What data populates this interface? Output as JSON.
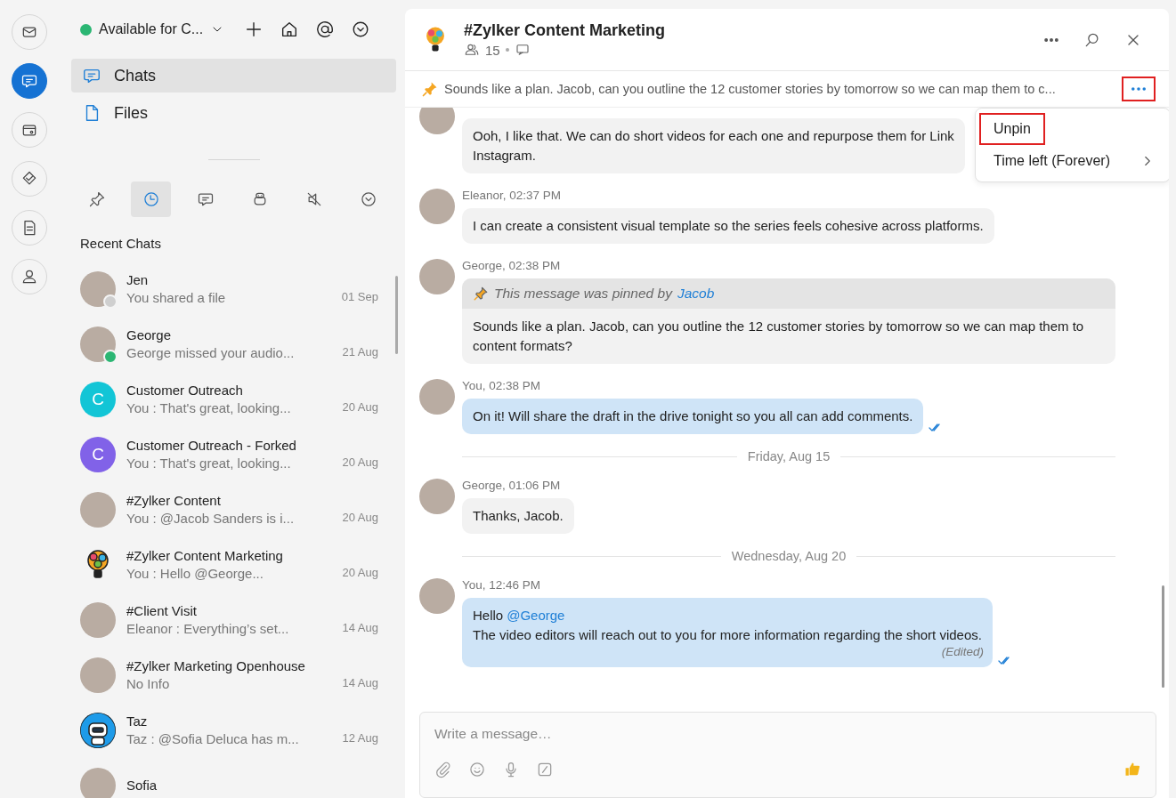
{
  "rail": [
    {
      "selected": false
    },
    {
      "selected": true
    },
    {
      "selected": false
    },
    {
      "selected": false
    },
    {
      "selected": false
    },
    {
      "selected": false
    }
  ],
  "panel": {
    "status": {
      "label": "Available for C...",
      "online": true
    },
    "nav": [
      {
        "label": "Chats",
        "selected": true
      },
      {
        "label": "Files",
        "selected": false
      }
    ],
    "filters": [
      {
        "selected": false
      },
      {
        "selected": true
      },
      {
        "selected": false
      },
      {
        "selected": false
      },
      {
        "selected": false
      },
      {
        "selected": false
      }
    ],
    "section_title": "Recent Chats",
    "chats": [
      {
        "name": "Jen",
        "preview": "You shared a file",
        "date": "01 Sep",
        "kind": "photo",
        "online": false
      },
      {
        "name": "George",
        "preview": "George missed your audio...",
        "date": "21 Aug",
        "kind": "photo",
        "online": true
      },
      {
        "name": "Customer Outreach",
        "preview": "You : That's great, looking...",
        "date": "20 Aug",
        "kind": "letter",
        "letter": "C",
        "color": "#12c5d6"
      },
      {
        "name": "Customer Outreach - Forked",
        "preview": "You : That's great, looking...",
        "date": "20 Aug",
        "kind": "letter",
        "letter": "C",
        "color": "#8162e8"
      },
      {
        "name": "#Zylker Content",
        "preview": "You : @Jacob Sanders  is i...",
        "date": "20 Aug",
        "kind": "photo"
      },
      {
        "name": "#Zylker Content Marketing",
        "preview": "You : Hello @George...",
        "date": "20 Aug",
        "kind": "bulb"
      },
      {
        "name": "#Client Visit",
        "preview": "Eleanor : Everything’s set...",
        "date": "14 Aug",
        "kind": "photo"
      },
      {
        "name": "#Zylker Marketing Openhouse",
        "preview": "No Info",
        "date": "14 Aug",
        "kind": "photo"
      },
      {
        "name": "Taz",
        "preview": "Taz : @Sofia Deluca has m...",
        "date": "12 Aug",
        "kind": "bot"
      },
      {
        "name": "Sofia",
        "kind": "photo"
      }
    ]
  },
  "chat": {
    "title": "#Zylker Content Marketing",
    "members": "15",
    "pinned": {
      "text": "Sounds like a plan. Jacob, can you outline the 12 customer stories by tomorrow so we can map them to c...",
      "more_highlighted": true,
      "menu": [
        {
          "label": "Unpin",
          "highlighted": true,
          "submenu": false
        },
        {
          "label": "Time left (Forever)",
          "highlighted": false,
          "submenu": true
        }
      ]
    },
    "messages": [
      {
        "kind": "message",
        "own": false,
        "lines": [
          "Ooh, I like that. We can do short videos for each one and repurpose them for Link",
          "Instagram."
        ]
      },
      {
        "kind": "message",
        "header": "Eleanor, 02:37 PM",
        "own": false,
        "lines": [
          "I can create a consistent visual template so the series feels cohesive across platforms."
        ]
      },
      {
        "kind": "message",
        "header": "George, 02:38 PM",
        "own": false,
        "pinned_by": {
          "text": "This message was pinned by",
          "by": "Jacob"
        },
        "lines": [
          "Sounds like a plan. Jacob, can you outline the 12 customer stories by tomorrow so we can map them to content formats?"
        ]
      },
      {
        "kind": "message",
        "header": "You, 02:38 PM",
        "own": true,
        "read": true,
        "lines": [
          "On it! Will share the draft in the drive tonight so you all can add comments."
        ]
      },
      {
        "kind": "divider",
        "label": "Friday, Aug 15"
      },
      {
        "kind": "message",
        "header": "George, 01:06 PM",
        "own": false,
        "lines": [
          "Thanks, Jacob."
        ]
      },
      {
        "kind": "divider",
        "label": "Wednesday, Aug 20"
      },
      {
        "kind": "message",
        "header": "You, 12:46 PM",
        "own": true,
        "read": true,
        "greeting": "Hello",
        "mention": "@George",
        "lines": [
          "The video editors will reach out to you for more information regarding the short videos."
        ],
        "edited": "(Edited)"
      }
    ],
    "composer": {
      "placeholder": "Write a message…"
    }
  }
}
